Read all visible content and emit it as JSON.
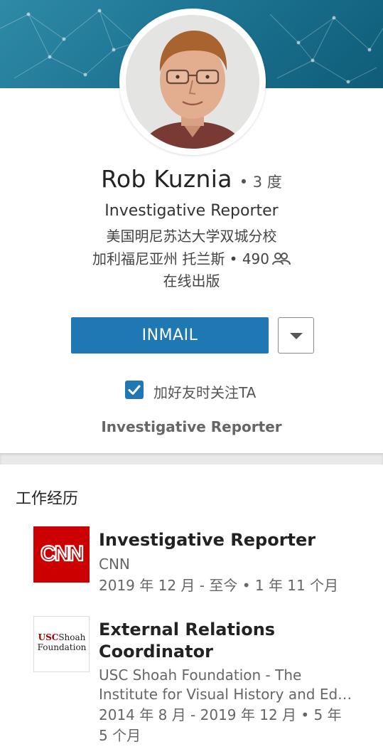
{
  "profile": {
    "name": "Rob Kuznia",
    "degree": "• 3 度",
    "title": "Investigative Reporter",
    "school": "美国明尼苏达大学双城分校",
    "location": "加利福尼亚州 托兰斯 • 490",
    "industry": "在线出版",
    "connections_icon": "people-icon"
  },
  "actions": {
    "inmail_label": "INMAIL",
    "dropdown_icon": "caret-down-icon",
    "follow_label": "加好友时关注TA",
    "follow_checked": true
  },
  "headline": "Investigative Reporter",
  "experience": {
    "section_title": "工作经历",
    "items": [
      {
        "title": "Investigative Reporter",
        "company": "CNN",
        "dates": "2019 年 12 月 - 至今 • 1 年 11 个月",
        "logo_text": "CNN"
      },
      {
        "title": "External Relations Coordinator",
        "company": "USC Shoah Foundation - The",
        "company_line2": "Institute for Visual History and Ed…",
        "dates": "2014 年 8 月 - 2019 年 12 月 • 5 年",
        "dates_line2": "5 个月",
        "logo_text_a": "USC",
        "logo_text_b": "Shoah",
        "logo_text_c": "Foundation"
      }
    ]
  },
  "colors": {
    "brand_blue": "#1f78b4",
    "banner_teal": "#1d7593",
    "cnn_red": "#cc0000"
  }
}
